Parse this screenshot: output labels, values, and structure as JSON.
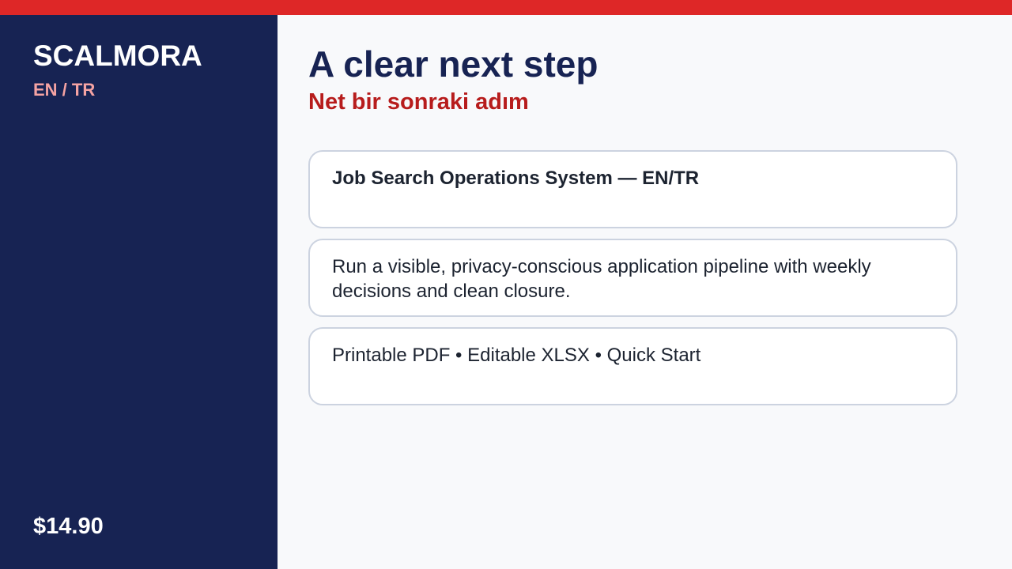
{
  "colors": {
    "accent_bar": "#de2727",
    "sidebar_bg": "#172353",
    "title": "#172353",
    "subtitle": "#b71c1c",
    "lang": "#f5a3a3",
    "card_border": "#ccd3e0",
    "background": "#f8f9fb"
  },
  "sidebar": {
    "brand": "SCALMORA",
    "languages": "EN / TR",
    "price": "$14.90"
  },
  "main": {
    "title": "A clear next step",
    "subtitle": "Net bir sonraki adım",
    "cards": [
      {
        "text": "Job Search Operations System — EN/TR"
      },
      {
        "text": "Run a visible, privacy-conscious application pipeline with weekly decisions and clean closure."
      },
      {
        "text": "Printable PDF • Editable XLSX • Quick Start"
      }
    ]
  }
}
